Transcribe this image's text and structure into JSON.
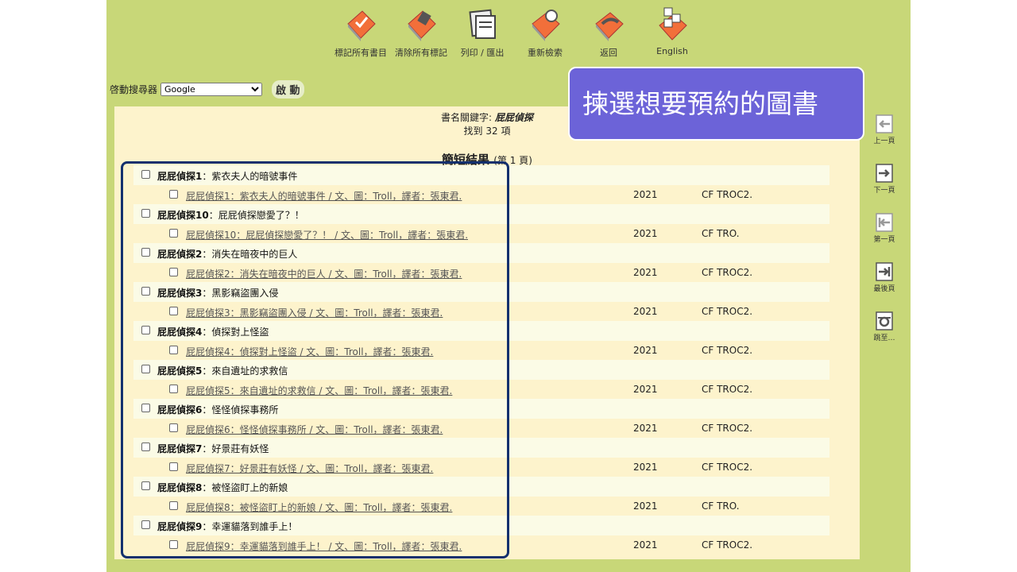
{
  "toolbar": [
    {
      "label": "標記所有書目",
      "icon": "mark-all-icon"
    },
    {
      "label": "清除所有標記",
      "icon": "clear-marks-icon"
    },
    {
      "label": "列印 / 匯出",
      "icon": "print-export-icon"
    },
    {
      "label": "重新檢索",
      "icon": "new-search-icon"
    },
    {
      "label": "返回",
      "icon": "back-icon"
    },
    {
      "label": "English",
      "icon": "english-icon"
    }
  ],
  "search_engine": {
    "label": "啓動搜尋器",
    "selected": "Google",
    "start_label": "啟 動"
  },
  "results": {
    "keyword_label": "書名關鍵字:",
    "keyword_value": "屁屁偵探",
    "found_text": "找到 32 項",
    "heading": "簡短結果",
    "page_text": "(第 1 頁)",
    "items": [
      {
        "series": "屁屁偵探1",
        "subtitle": "：紫衣夫人的暗號事件",
        "link": "屁屁偵探1：紫衣夫人的暗號事件 / 文、圖：Troll，譯者：張東君.",
        "year": "2021",
        "call_no": "CF TROC2."
      },
      {
        "series": "屁屁偵探10",
        "subtitle": "：屁屁偵探戀愛了？！",
        "link": "屁屁偵探10：屁屁偵探戀愛了？！ / 文、圖：Troll，譯者：張東君.",
        "year": "2021",
        "call_no": "CF TRO."
      },
      {
        "series": "屁屁偵探2",
        "subtitle": "：消失在暗夜中的巨人",
        "link": "屁屁偵探2：消失在暗夜中的巨人 / 文、圖：Troll，譯者：張東君.",
        "year": "2021",
        "call_no": "CF TROC2."
      },
      {
        "series": "屁屁偵探3",
        "subtitle": "：黑影竊盜團入侵",
        "link": "屁屁偵探3：黑影竊盜團入侵 / 文、圖：Troll，譯者：張東君.",
        "year": "2021",
        "call_no": "CF TROC2."
      },
      {
        "series": "屁屁偵探4",
        "subtitle": "：偵探對上怪盜",
        "link": "屁屁偵探4：偵探對上怪盜 / 文、圖：Troll，譯者：張東君.",
        "year": "2021",
        "call_no": "CF TROC2."
      },
      {
        "series": "屁屁偵探5",
        "subtitle": "：來自遺址的求救信",
        "link": "屁屁偵探5：來自遺址的求救信 / 文、圖：Troll，譯者：張東君.",
        "year": "2021",
        "call_no": "CF TROC2."
      },
      {
        "series": "屁屁偵探6",
        "subtitle": "：怪怪偵探事務所",
        "link": "屁屁偵探6：怪怪偵探事務所 / 文、圖：Troll，譯者：張東君.",
        "year": "2021",
        "call_no": "CF TROC2."
      },
      {
        "series": "屁屁偵探7",
        "subtitle": "：好景莊有妖怪",
        "link": "屁屁偵探7：好景莊有妖怪 / 文、圖：Troll，譯者：張東君.",
        "year": "2021",
        "call_no": "CF TROC2."
      },
      {
        "series": "屁屁偵探8",
        "subtitle": "：被怪盜盯上的新娘",
        "link": "屁屁偵探8：被怪盜盯上的新娘 / 文、圖：Troll，譯者：張東君.",
        "year": "2021",
        "call_no": "CF TRO."
      },
      {
        "series": "屁屁偵探9",
        "subtitle": "：幸運貓落到誰手上！",
        "link": "屁屁偵探9：幸運貓落到誰手上！ / 文、圖：Troll，譯者：張東君.",
        "year": "2021",
        "call_no": "CF TROC2."
      }
    ]
  },
  "sidenav": [
    {
      "label": "上一頁",
      "icon": "prev-page-icon"
    },
    {
      "label": "下一頁",
      "icon": "next-page-icon"
    },
    {
      "label": "第一頁",
      "icon": "first-page-icon"
    },
    {
      "label": "最後頁",
      "icon": "last-page-icon"
    },
    {
      "label": "跳至…",
      "icon": "jump-to-icon"
    }
  ],
  "callout": {
    "text": "揀選想要預約的圖書"
  },
  "colors": {
    "page_bg": "#c8d778",
    "panel_bg": "#fdf3cc",
    "callout_bg": "#6c63d8",
    "highlight_border": "#14306e",
    "icon_orange": "#f26f3a"
  }
}
